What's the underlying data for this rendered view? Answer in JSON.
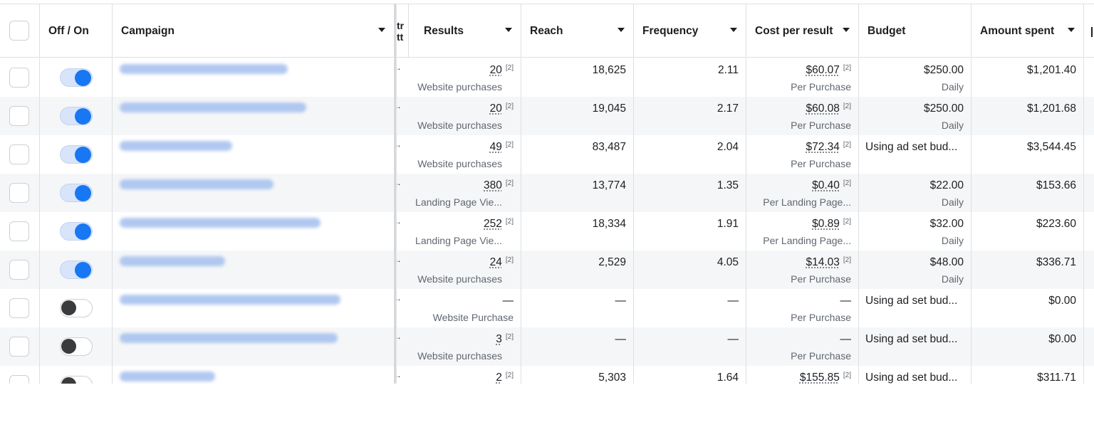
{
  "columns": {
    "toggle": "Off / On",
    "campaign": "Campaign",
    "attribution_fragment": [
      "tr",
      "tt"
    ],
    "results": "Results",
    "reach": "Reach",
    "frequency": "Frequency",
    "cost_per_result": "Cost per result",
    "budget": "Budget",
    "amount_spent": "Amount spent"
  },
  "footnote_marker": "[2]",
  "ellipsis": "..",
  "rows": [
    {
      "toggle": "on",
      "result": "20",
      "result_type": "Website purchases",
      "reach": "18,625",
      "frequency": "2.11",
      "cpr": "$60.07",
      "cpr_type": "Per Purchase",
      "budget": "$250.00",
      "budget_period": "Daily",
      "spent": "$1,201.40"
    },
    {
      "toggle": "on",
      "result": "20",
      "result_type": "Website purchases",
      "reach": "19,045",
      "frequency": "2.17",
      "cpr": "$60.08",
      "cpr_type": "Per Purchase",
      "budget": "$250.00",
      "budget_period": "Daily",
      "spent": "$1,201.68"
    },
    {
      "toggle": "on",
      "result": "49",
      "result_type": "Website purchases",
      "reach": "83,487",
      "frequency": "2.04",
      "cpr": "$72.34",
      "cpr_type": "Per Purchase",
      "budget": "Using ad set bud...",
      "budget_period": "",
      "spent": "$3,544.45"
    },
    {
      "toggle": "on",
      "result": "380",
      "result_type": "Landing Page Vie...",
      "reach": "13,774",
      "frequency": "1.35",
      "cpr": "$0.40",
      "cpr_type": "Per Landing Page...",
      "budget": "$22.00",
      "budget_period": "Daily",
      "spent": "$153.66"
    },
    {
      "toggle": "on",
      "result": "252",
      "result_type": "Landing Page Vie...",
      "reach": "18,334",
      "frequency": "1.91",
      "cpr": "$0.89",
      "cpr_type": "Per Landing Page...",
      "budget": "$32.00",
      "budget_period": "Daily",
      "spent": "$223.60"
    },
    {
      "toggle": "on",
      "result": "24",
      "result_type": "Website purchases",
      "reach": "2,529",
      "frequency": "4.05",
      "cpr": "$14.03",
      "cpr_type": "Per Purchase",
      "budget": "$48.00",
      "budget_period": "Daily",
      "spent": "$336.71"
    },
    {
      "toggle": "off",
      "result": "—",
      "result_type": "Website Purchase",
      "reach": "—",
      "frequency": "—",
      "cpr": "—",
      "cpr_type": "Per Purchase",
      "budget": "Using ad set bud...",
      "budget_period": "",
      "spent": "$0.00"
    },
    {
      "toggle": "off",
      "result": "3",
      "result_type": "Website purchases",
      "reach": "—",
      "frequency": "—",
      "cpr": "—",
      "cpr_type": "Per Purchase",
      "budget": "Using ad set bud...",
      "budget_period": "",
      "spent": "$0.00"
    },
    {
      "toggle": "off",
      "result": "2",
      "result_type": "",
      "reach": "5,303",
      "frequency": "1.64",
      "cpr": "$155.85",
      "cpr_type": "",
      "budget": "Using ad set bud...",
      "budget_period": "",
      "spent": "$311.71"
    }
  ]
}
